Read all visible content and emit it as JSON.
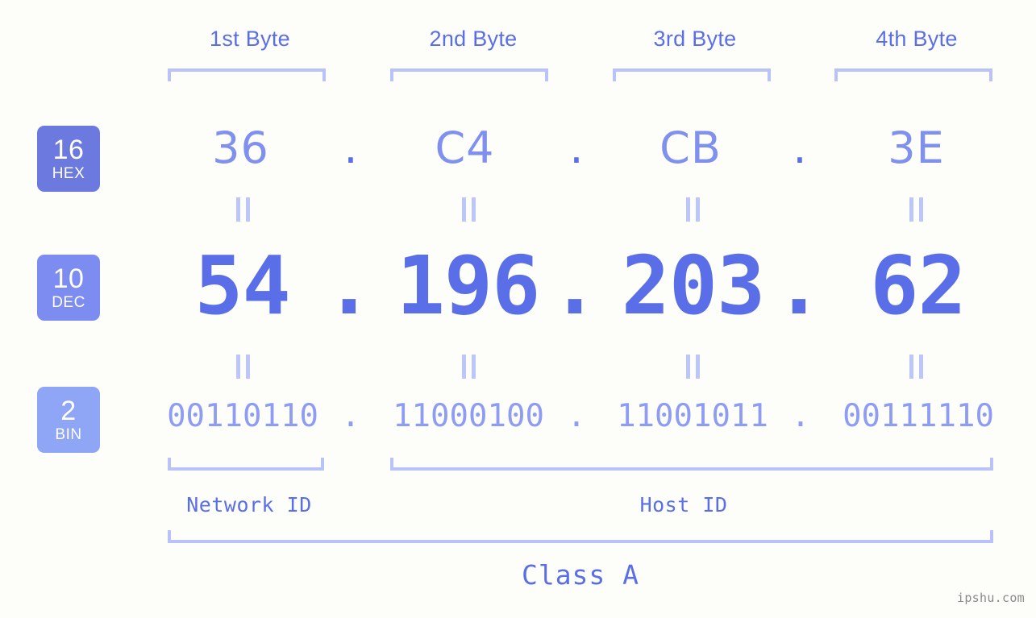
{
  "colors": {
    "background": "#fdfdfa",
    "accent": "#5a6ee8",
    "bracket": "#b9c3f9",
    "hex_value": "#8090ef",
    "dec_value": "#5a6ee8",
    "bin_value": "#8e9df3",
    "badge_hex": "#6c7ae0",
    "badge_dec": "#7d8cf0",
    "badge_bin": "#8fa5f5",
    "equals": "#bcc6fa",
    "watermark": "#8a8a8a"
  },
  "header": {
    "byte_labels": [
      "1st Byte",
      "2nd Byte",
      "3rd Byte",
      "4th Byte"
    ]
  },
  "radix_badges": [
    {
      "number": "16",
      "name": "HEX"
    },
    {
      "number": "10",
      "name": "DEC"
    },
    {
      "number": "2",
      "name": "BIN"
    }
  ],
  "rows": {
    "hex": {
      "octets": [
        "36",
        "C4",
        "CB",
        "3E"
      ],
      "separator": "."
    },
    "dec": {
      "octets": [
        "54",
        "196",
        "203",
        "62"
      ],
      "separator": "."
    },
    "bin": {
      "octets": [
        "00110110",
        "11000100",
        "11001011",
        "00111110"
      ],
      "separator": "."
    }
  },
  "equals_symbol": "||",
  "footer": {
    "network_id_label": "Network ID",
    "host_id_label": "Host ID",
    "class_label": "Class A"
  },
  "watermark": "ipshu.com"
}
